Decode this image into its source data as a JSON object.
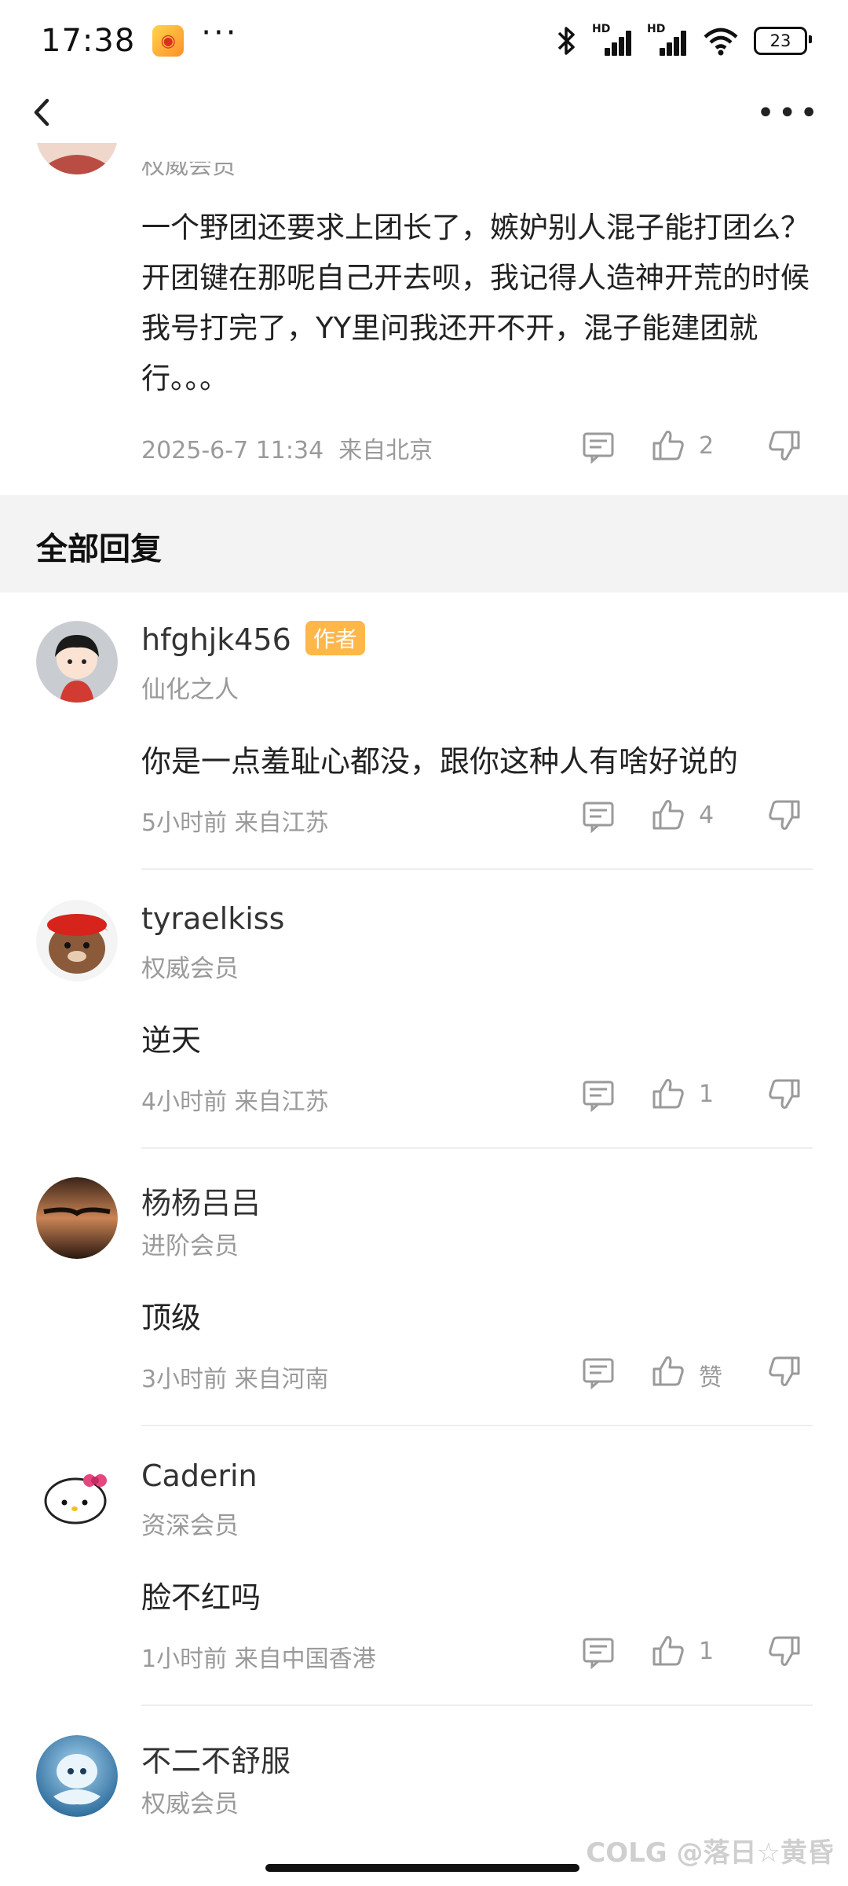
{
  "status_bar": {
    "time": "17:38",
    "battery": "23",
    "signal_labels": [
      "HD",
      "HD"
    ]
  },
  "nav": {
    "more_label": "•••"
  },
  "top_comment": {
    "level_partial": "权威会员",
    "text": "一个野团还要求上团长了，嫉妒别人混子能打团么？开团键在那呢自己开去呗，我记得人造神开荒的时候我号打完了，YY里问我还开不开，混子能建团就行。。。",
    "time": "2025-6-7 11:34",
    "location": "来自北京",
    "likes": "2"
  },
  "section": {
    "title": "全部回复"
  },
  "replies": [
    {
      "name": "hfghjk456",
      "badge": "作者",
      "level": "仙化之人",
      "text": "你是一点羞耻心都没，跟你这种人有啥好说的",
      "time": "5小时前",
      "location": "来自江苏",
      "likes": "4"
    },
    {
      "name": "tyraelkiss",
      "badge": "",
      "level": "权威会员",
      "text": "逆天",
      "time": "4小时前",
      "location": "来自江苏",
      "likes": "1"
    },
    {
      "name": "杨杨吕吕",
      "badge": "",
      "level": "进阶会员",
      "text": "顶级",
      "time": "3小时前",
      "location": "来自河南",
      "likes": "赞"
    },
    {
      "name": "Caderin",
      "badge": "",
      "level": "资深会员",
      "text": "脸不红吗",
      "time": "1小时前",
      "location": "来自中国香港",
      "likes": "1"
    },
    {
      "name": "不二不舒服",
      "badge": "",
      "level": "权威会员",
      "text": "",
      "time": "",
      "location": "",
      "likes": ""
    }
  ],
  "watermark": "COLG @落日☆黄昏",
  "colors": {
    "badge": "#ffb74a",
    "section_bg": "#f3f3f3",
    "meta_gray": "#9a9a9a"
  },
  "icons": [
    "back-icon",
    "more-icon",
    "reply-icon",
    "like-icon",
    "dislike-icon"
  ]
}
